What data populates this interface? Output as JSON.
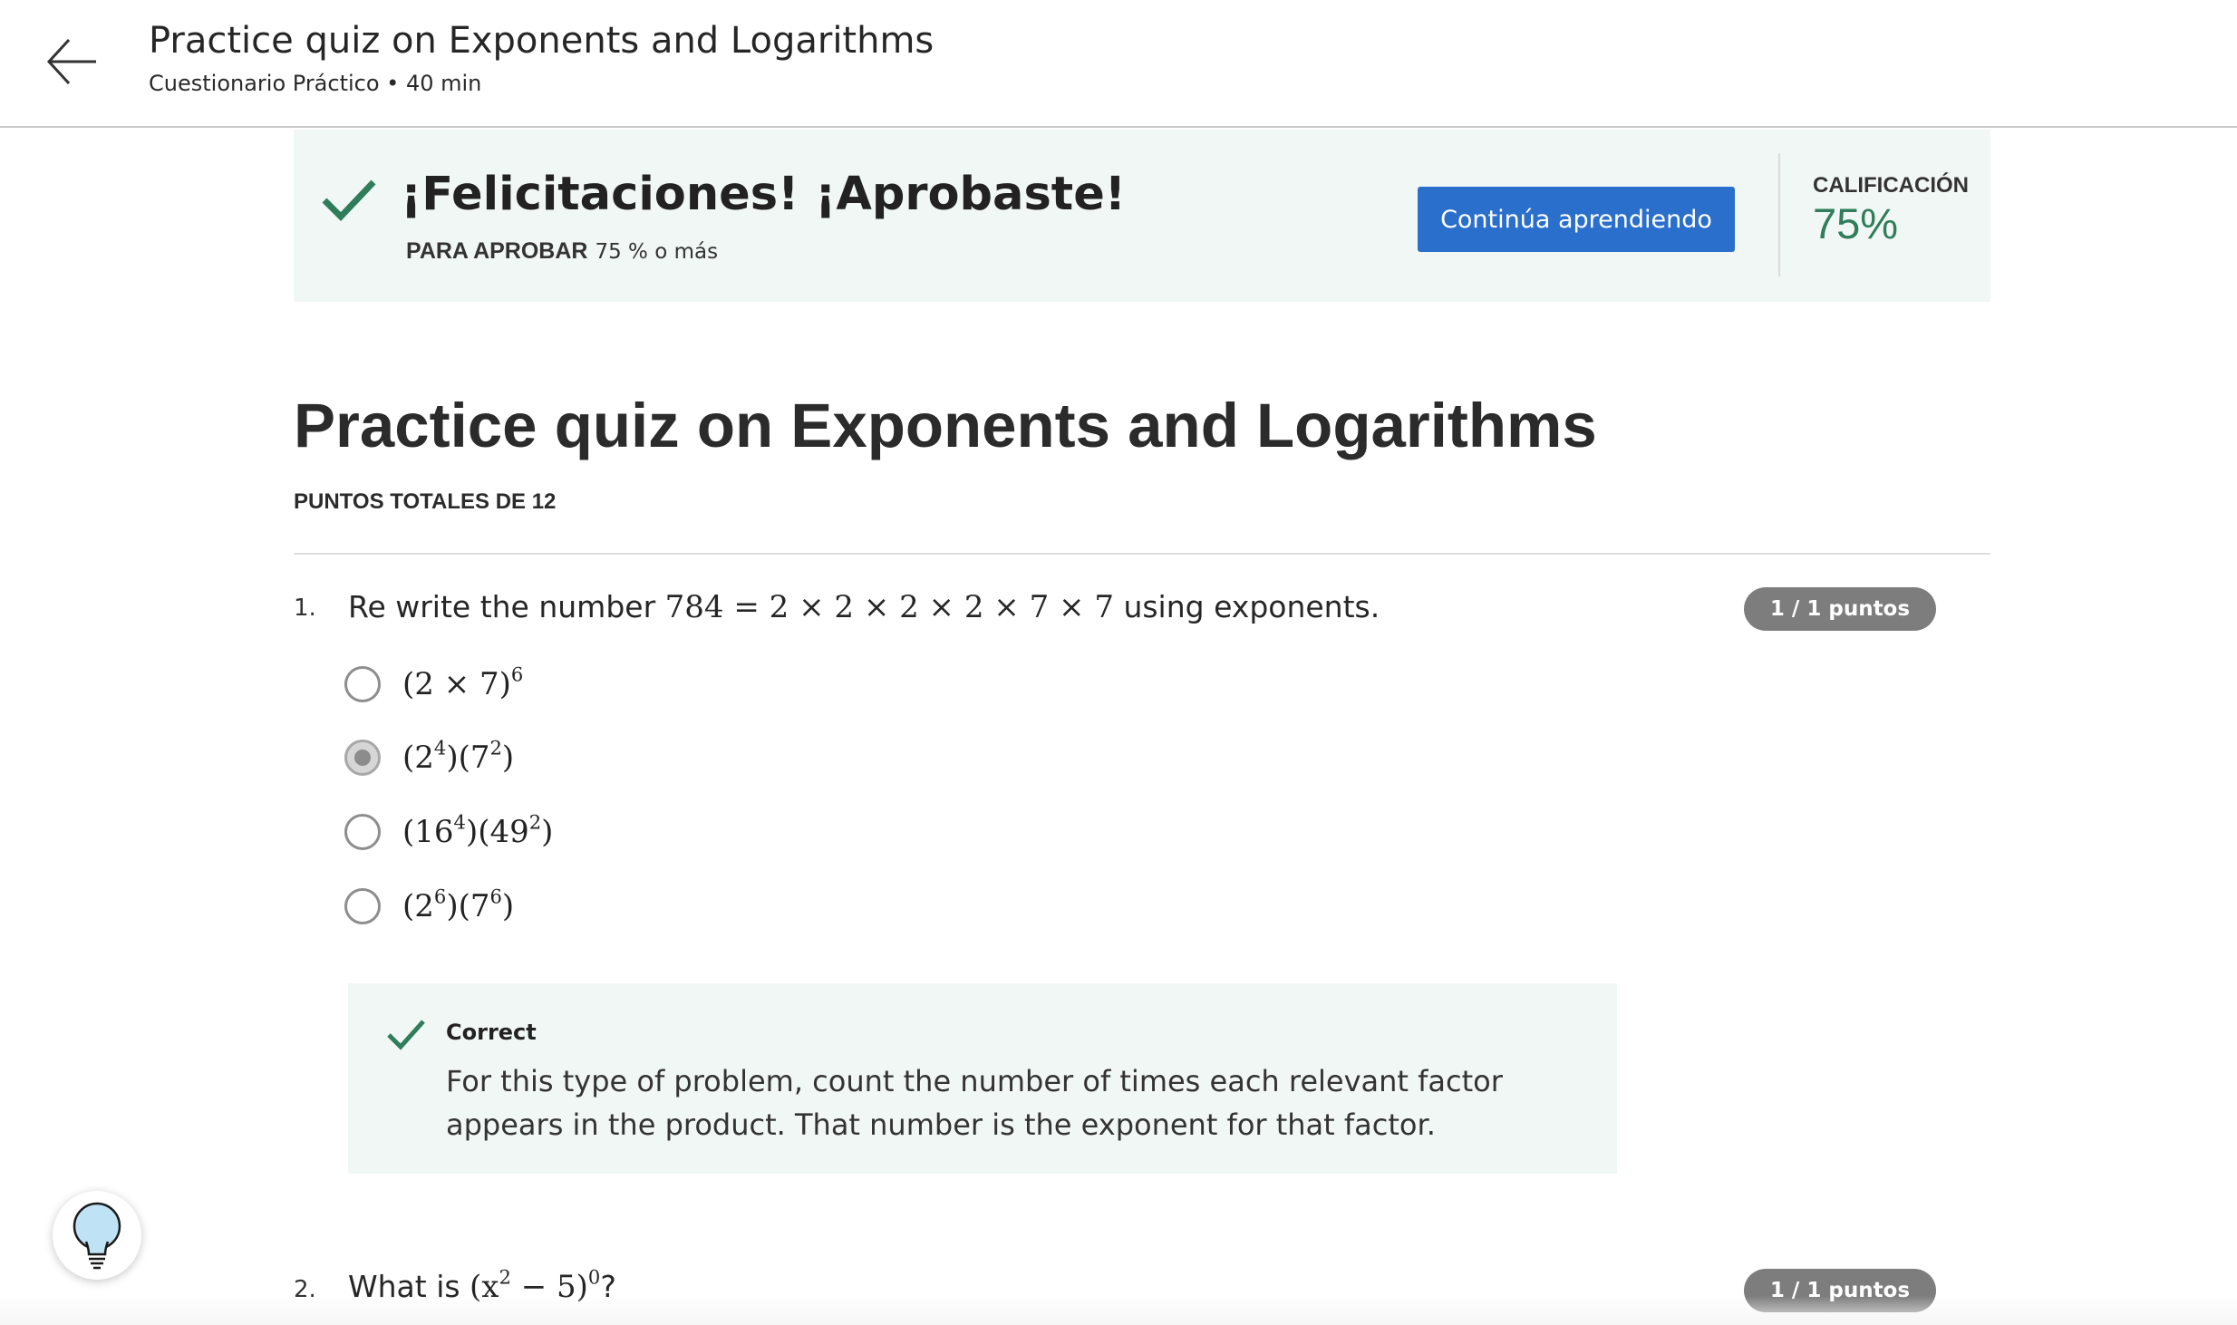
{
  "header": {
    "title": "Practice quiz on Exponents and Logarithms",
    "subtitle": "Cuestionario Práctico • 40 min",
    "back_icon": "arrow-left-icon"
  },
  "banner": {
    "title": "¡Felicitaciones! ¡Aprobaste!",
    "pass_label": "PARA APROBAR",
    "pass_value": "75 % o más",
    "button_label": "Continúa aprendiendo",
    "grade_label": "CALIFICACIÓN",
    "grade_value": "75%",
    "accent_color": "#2f7d5a",
    "button_color": "#2b6fcc"
  },
  "quiz": {
    "title": "Practice quiz on Exponents and Logarithms",
    "total_points": "PUNTOS TOTALES DE 12",
    "questions": [
      {
        "number": "1.",
        "text_before": "Re write the number ",
        "math": "784 = 2 × 2 × 2 × 2 × 7 × 7",
        "text_after": " using exponents.",
        "points": "1 / 1 puntos",
        "options": [
          {
            "base": "(2 × 7)",
            "sup": "6",
            "selected": false
          },
          {
            "part1": "(2",
            "sup1": "4",
            "part2": ")(7",
            "sup2": "2",
            "part3": ")",
            "selected": true
          },
          {
            "part1": "(16",
            "sup1": "4",
            "part2": ")(49",
            "sup2": "2",
            "part3": ")",
            "selected": false
          },
          {
            "part1": "(2",
            "sup1": "6",
            "part2": ")(7",
            "sup2": "6",
            "part3": ")",
            "selected": false
          }
        ],
        "feedback": {
          "label": "Correct",
          "text": "For this type of problem, count the number of times each relevant factor appears in the product. That number is the exponent for that factor."
        }
      },
      {
        "number": "2.",
        "text_before": "What is ",
        "math_base": "(x",
        "math_sup1": "2",
        "math_mid": " − 5)",
        "math_sup2": "0",
        "text_after": "?",
        "points": "1 / 1 puntos"
      }
    ]
  },
  "help": {
    "icon": "lightbulb-icon"
  }
}
